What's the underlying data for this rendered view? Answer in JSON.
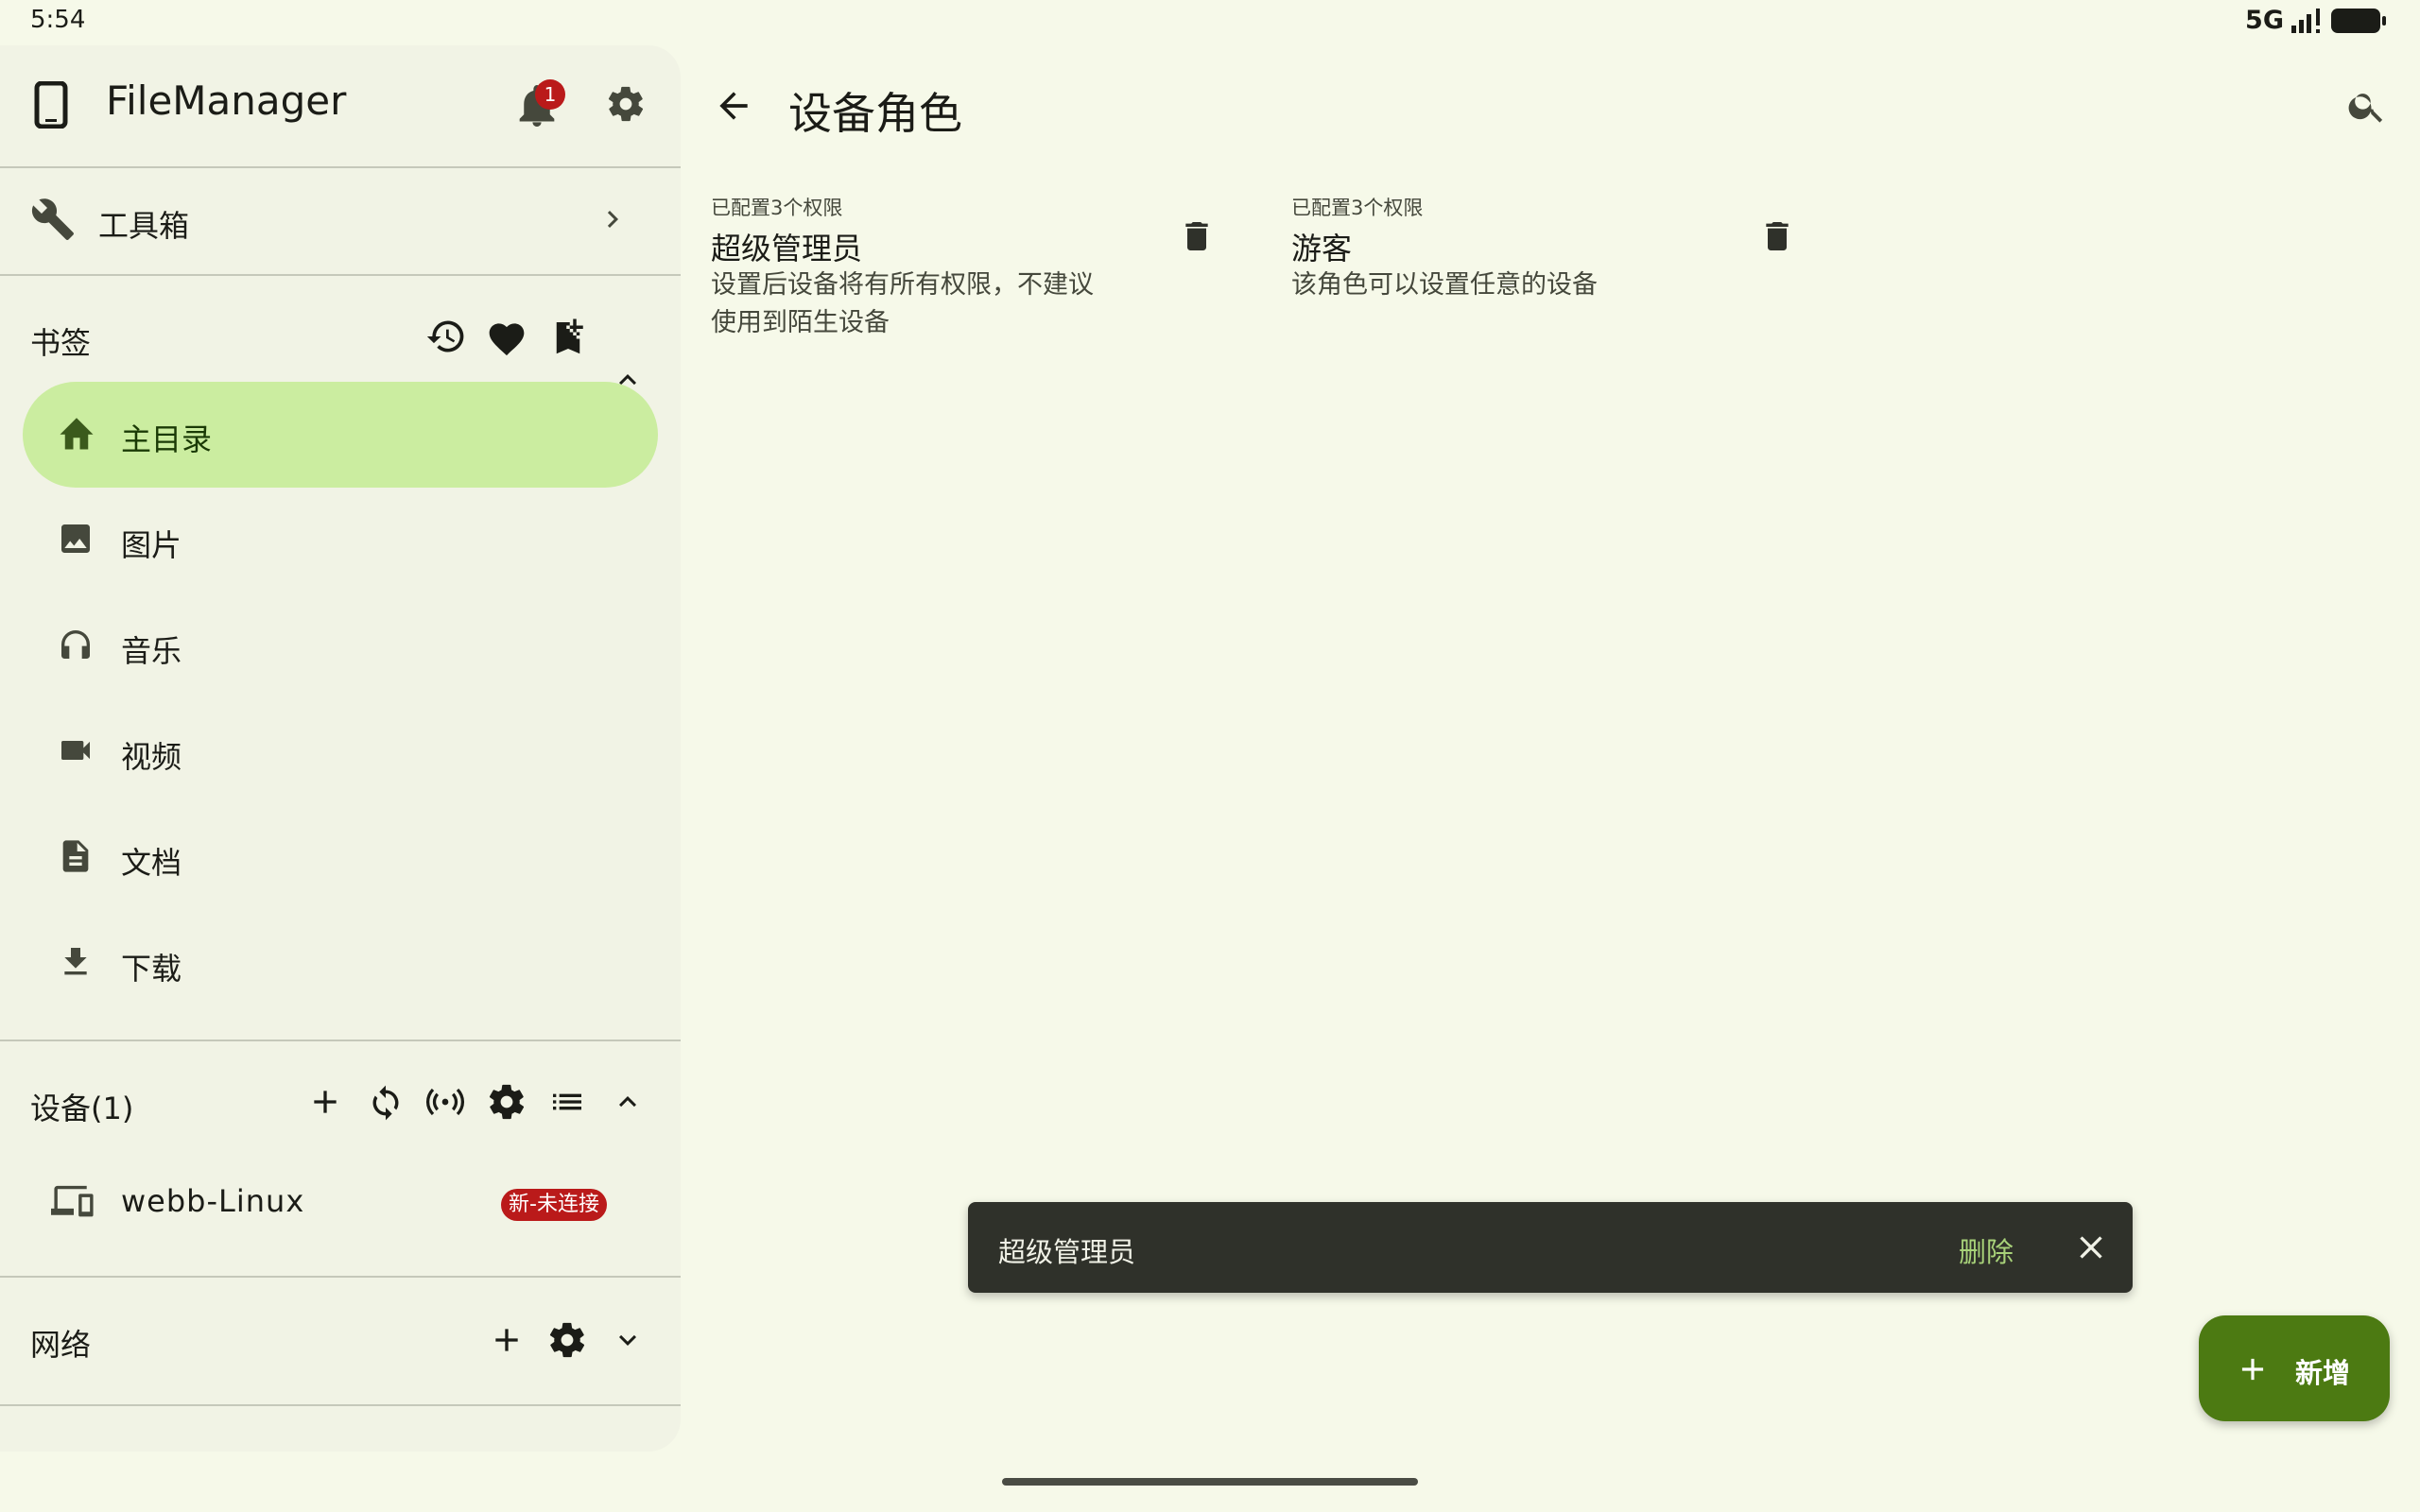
{
  "status_bar": {
    "time": "5:54",
    "network": "5G"
  },
  "sidebar": {
    "app_title": "FileManager",
    "notification_count": "1",
    "toolbox_label": "工具箱",
    "bookmarks": {
      "title": "书签",
      "items": [
        {
          "label": "主目录",
          "icon": "home-icon",
          "active": true
        },
        {
          "label": "图片",
          "icon": "image-icon"
        },
        {
          "label": "音乐",
          "icon": "headphones-icon"
        },
        {
          "label": "视频",
          "icon": "video-icon"
        },
        {
          "label": "文档",
          "icon": "document-icon"
        },
        {
          "label": "下载",
          "icon": "download-icon"
        }
      ]
    },
    "devices": {
      "title": "设备(1)",
      "items": [
        {
          "label": "webb-Linux",
          "tag": "新-未连接"
        }
      ]
    },
    "network": {
      "title": "网络"
    }
  },
  "main": {
    "title": "设备角色",
    "roles": [
      {
        "meta": "已配置3个权限",
        "name": "超级管理员",
        "description": "设置后设备将有所有权限，不建议使用到陌生设备"
      },
      {
        "meta": "已配置3个权限",
        "name": "游客",
        "description": "该角色可以设置任意的设备"
      }
    ]
  },
  "snackbar": {
    "message": "超级管理员",
    "action": "删除"
  },
  "fab": {
    "label": "新增"
  },
  "colors": {
    "accent": "#4c7a12",
    "active_bg": "#cbeda0",
    "badge": "#ba1a1a",
    "snackbar_bg": "#2f312a",
    "snackbar_action": "#a8d279"
  }
}
